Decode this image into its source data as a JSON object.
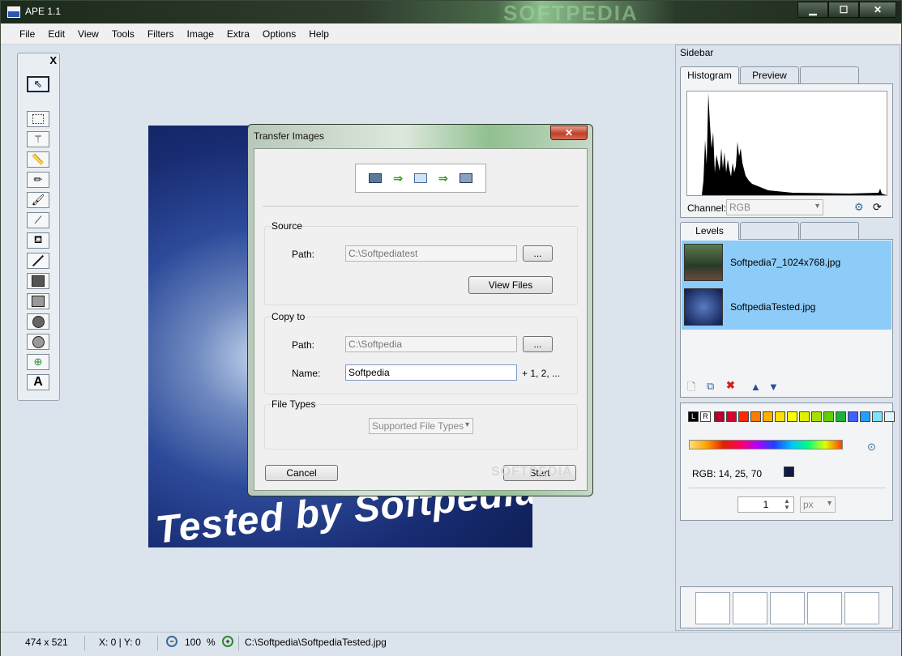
{
  "window": {
    "title": "APE 1.1",
    "watermark": "SOFTPEDIA",
    "minimize": "▁",
    "maximize": "☐",
    "close": "✕"
  },
  "menu": [
    "File",
    "Edit",
    "View",
    "Tools",
    "Filters",
    "Image",
    "Extra",
    "Options",
    "Help"
  ],
  "toolbox": {
    "close": "X"
  },
  "canvas": {
    "image_text": "Tested by Softpedia"
  },
  "dialog": {
    "title": "Transfer Images",
    "close": "✕",
    "source": {
      "label": "Source",
      "path_label": "Path:",
      "path_value": "C:\\Softpediatest",
      "browse": "...",
      "view_files": "View Files"
    },
    "copy_to": {
      "label": "Copy to",
      "path_label": "Path:",
      "path_value": "C:\\Softpedia",
      "browse": "...",
      "name_label": "Name:",
      "name_value": "Softpedia",
      "suffix": "+ 1, 2, ..."
    },
    "file_types": {
      "label": "File Types",
      "selected": "Supported File Types"
    },
    "cancel": "Cancel",
    "start": "Start",
    "watermark": "SOFTPEDIA"
  },
  "sidebar": {
    "title": "Sidebar",
    "top_tabs": [
      "Histogram",
      "Preview",
      ""
    ],
    "channel_label": "Channel:",
    "channel_value": "RGB",
    "layer_tabs": [
      "Levels",
      "",
      ""
    ],
    "layers": [
      {
        "name": "Softpedia7_1024x768.jpg"
      },
      {
        "name": "SoftpediaTested.jpg"
      }
    ],
    "rgb_label": "RGB: 14, 25, 70",
    "size_value": "1",
    "unit_value": "px",
    "palette_bw": [
      "L",
      "R"
    ],
    "palette": [
      "#b4002a",
      "#d8002c",
      "#ff2a00",
      "#ff7a00",
      "#ffb000",
      "#ffe000",
      "#ffff00",
      "#e0f000",
      "#a8e000",
      "#60d000",
      "#20b040",
      "#4060ff",
      "#20a0ff",
      "#80e0ff",
      "#e0f4ff"
    ],
    "current_color": "#0e1946"
  },
  "status": {
    "dimensions": "474 x 521",
    "coords": "X: 0 | Y: 0",
    "zoom": "100",
    "zoom_unit": "%",
    "path": "C:\\Softpedia\\SoftpediaTested.jpg"
  }
}
